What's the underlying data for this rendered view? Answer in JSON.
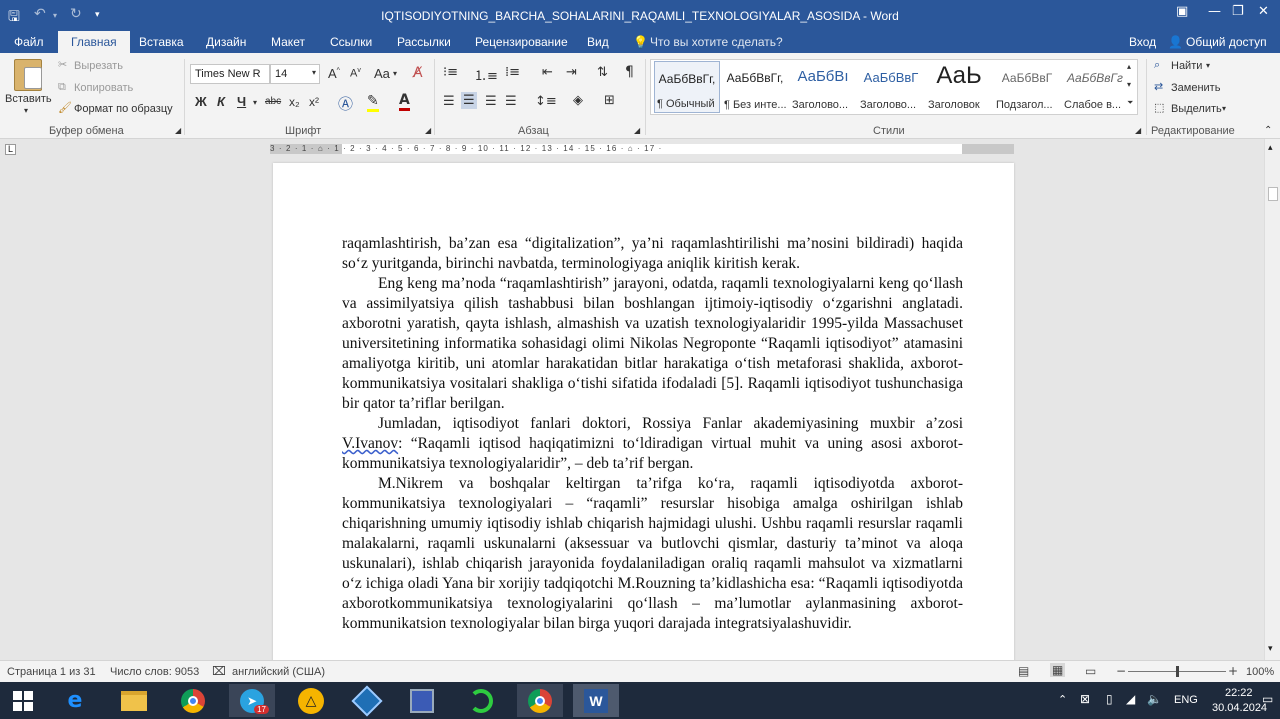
{
  "title_bar": {
    "title": "IQTISODIYOTNING_BARCHA_SOHALARINI_RAQAMLI_TEXNOLOGIYALAR_ASOSIDA - Word",
    "icons": [
      "save-icon",
      "undo-icon",
      "redo-icon",
      "customize-icon",
      "ribbon-display-icon",
      "minimize-icon",
      "restore-icon",
      "close-icon"
    ]
  },
  "tabs": {
    "file": "Файл",
    "home": "Главная",
    "insert": "Вставка",
    "design": "Дизайн",
    "layout": "Макет",
    "references": "Ссылки",
    "mailings": "Рассылки",
    "review": "Рецензирование",
    "view": "Вид",
    "tell_me": "Что вы хотите сделать?",
    "sign_in": "Вход",
    "share": "Общий доступ"
  },
  "ribbon": {
    "clipboard": {
      "paste": "Вставить",
      "cut": "Вырезать",
      "copy": "Копировать",
      "format_painter": "Формат по образцу",
      "label": "Буфер обмена"
    },
    "font": {
      "font_name": "Times New R",
      "font_size": "14",
      "bold": "Ж",
      "italic": "К",
      "underline": "Ч",
      "strike": "abc",
      "subscript": "x₂",
      "superscript": "x²",
      "change_case": "Aa",
      "label": "Шрифт"
    },
    "paragraph": {
      "label": "Абзац"
    },
    "styles": {
      "label": "Стили",
      "items": [
        {
          "preview": "АаБбВвГг,",
          "name": "¶ Обычный"
        },
        {
          "preview": "АаБбВвГг,",
          "name": "¶ Без инте..."
        },
        {
          "preview": "АаБбВı",
          "name": "Заголово..."
        },
        {
          "preview": "АаБбВвГ",
          "name": "Заголово..."
        },
        {
          "preview": "АаЬ",
          "name": "Заголовок"
        },
        {
          "preview": "АаБбВвГ",
          "name": "Подзагол..."
        },
        {
          "preview": "АаБбВвГг",
          "name": "Слабое в..."
        }
      ]
    },
    "editing": {
      "find": "Найти",
      "replace": "Заменить",
      "select": "Выделить",
      "label": "Редактирование"
    }
  },
  "ruler": {
    "text": "3 · 2 · 1 · ⌂ · 1 · 2 · 3 · 4 · 5 · 6 · 7 · 8 · 9 · 10 · 11 · 12 · 13 · 14 · 15 · 16 · ⌂ · 17 ·"
  },
  "document": {
    "p1": "raqamlashtirish, ba’zan esa “digitalization”, ya’ni raqamlashtirilishi ma’nosini bildiradi) haqida so‘z yuritganda, birinchi navbatda, terminologiyaga aniqlik kiritish kerak.",
    "p2": "Eng keng ma’noda “raqamlashtirish” jarayoni, odatda, raqamli texnologiyalarni keng qo‘llash va assimilyatsiya qilish tashabbusi bilan boshlangan ijtimoiy-iqtisodiy o‘zgarishni anglatadi. axborotni yaratish, qayta ishlash, almashish va uzatish texnologiyalaridir 1995-yilda Massachuset universitetining informatika sohasidagi olimi Nikolas Negroponte “Raqamli iqtisodiyot” atamasini amaliyotga kiritib, uni atomlar harakatidan bitlar harakatiga o‘tish metaforasi shaklida, axborot-kommunikatsiya vositalari shakliga o‘tishi sifatida ifodaladi [5]. Raqamli iqtisodiyot tushunchasiga bir qator ta’riflar berilgan.",
    "p3_start": "Jumladan, iqtisodiyot fanlari doktori, Rossiya Fanlar akademiyasining muxbir a’zosi ",
    "p3_squig": "V.Ivanov",
    "p3_end": ": “Raqamli iqtisod haqiqatimizni to‘ldiradigan virtual muhit va uning asosi axborot-kommunikatsiya texnologiyalaridir”, – deb ta’rif bergan.",
    "p4": "M.Nikrem va boshqalar keltirgan ta’rifga ko‘ra, raqamli iqtisodiyotda axborot-kommunikatsiya texnologiyalari – “raqamli” resurslar hisobiga amalga oshirilgan ishlab chiqarishning umumiy iqtisodiy ishlab chiqarish hajmidagi ulushi. Ushbu raqamli resurslar raqamli malakalarni, raqamli uskunalarni (aksessuar va butlovchi qismlar, dasturiy ta’minot va aloqa uskunalari), ishlab chiqarish jarayonida foydalaniladigan oraliq raqamli mahsulot va xizmatlarni o‘z ichiga oladi Yana bir xorijiy tadqiqotchi M.Rouzning ta’kidlashicha esa: “Raqamli iqtisodiyotda axborotkommunikatsiya texnologiyalarini qo‘llash – ma’lumotlar aylanmasining axborot-kommunikatsion texnologiyalar bilan birga yuqori darajada integratsiyalashuvidir."
  },
  "status": {
    "page": "Страница 1 из 31",
    "words": "Число слов: 9053",
    "language": "английский (США)",
    "zoom": "100%",
    "zoom_level": 100
  },
  "taskbar": {
    "apps": [
      "start-icon",
      "edge-icon",
      "explorer-icon",
      "chrome-icon",
      "telegram-icon",
      "autocad-icon",
      "virtualbox-icon",
      "floppy-icon",
      "green-app-icon",
      "chrome2-icon",
      "word-icon"
    ],
    "telegram_badge": "17",
    "lang": "ENG",
    "time": "22:22",
    "date": "30.04.2024"
  },
  "colors": {
    "word_blue": "#2b579a",
    "taskbar": "#1e2a3c",
    "font_color": "#c00000",
    "highlight": "#ffff00"
  }
}
